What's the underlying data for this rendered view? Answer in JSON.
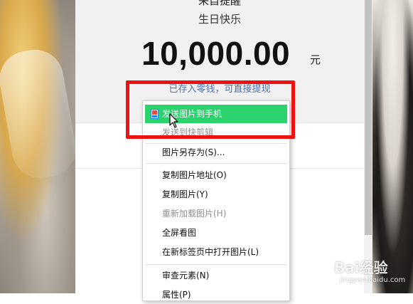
{
  "panel": {
    "sender_name": "来自提醒",
    "greeting": "生日快乐",
    "amount": "10,000.00",
    "currency": "元",
    "note": "已存入零钱，可直接提现"
  },
  "context_menu": {
    "items": [
      {
        "label": "发送图片到手机",
        "state": "highlighted",
        "icon": "phone-send-icon"
      },
      {
        "label": "发送到快剪辑",
        "state": "disabled"
      },
      {
        "label": "图片另存为(S)...",
        "state": "enabled"
      },
      {
        "label": "复制图片地址(O)",
        "state": "enabled"
      },
      {
        "label": "复制图片(Y)",
        "state": "enabled"
      },
      {
        "label": "重新加载图片(H)",
        "state": "disabled"
      },
      {
        "label": "全屏看图",
        "state": "enabled"
      },
      {
        "label": "在新标签页中打开图片(L)",
        "state": "enabled"
      },
      {
        "label": "审查元素(N)",
        "state": "enabled"
      },
      {
        "label": "属性(P)",
        "state": "enabled"
      }
    ]
  },
  "watermark": {
    "text": "Bai经验",
    "sub": "jingyan.baidu.com"
  },
  "colors": {
    "highlight_green": "#2ad36c",
    "annotation_red": "#ee1111",
    "note_blue": "#4a6fb0"
  }
}
